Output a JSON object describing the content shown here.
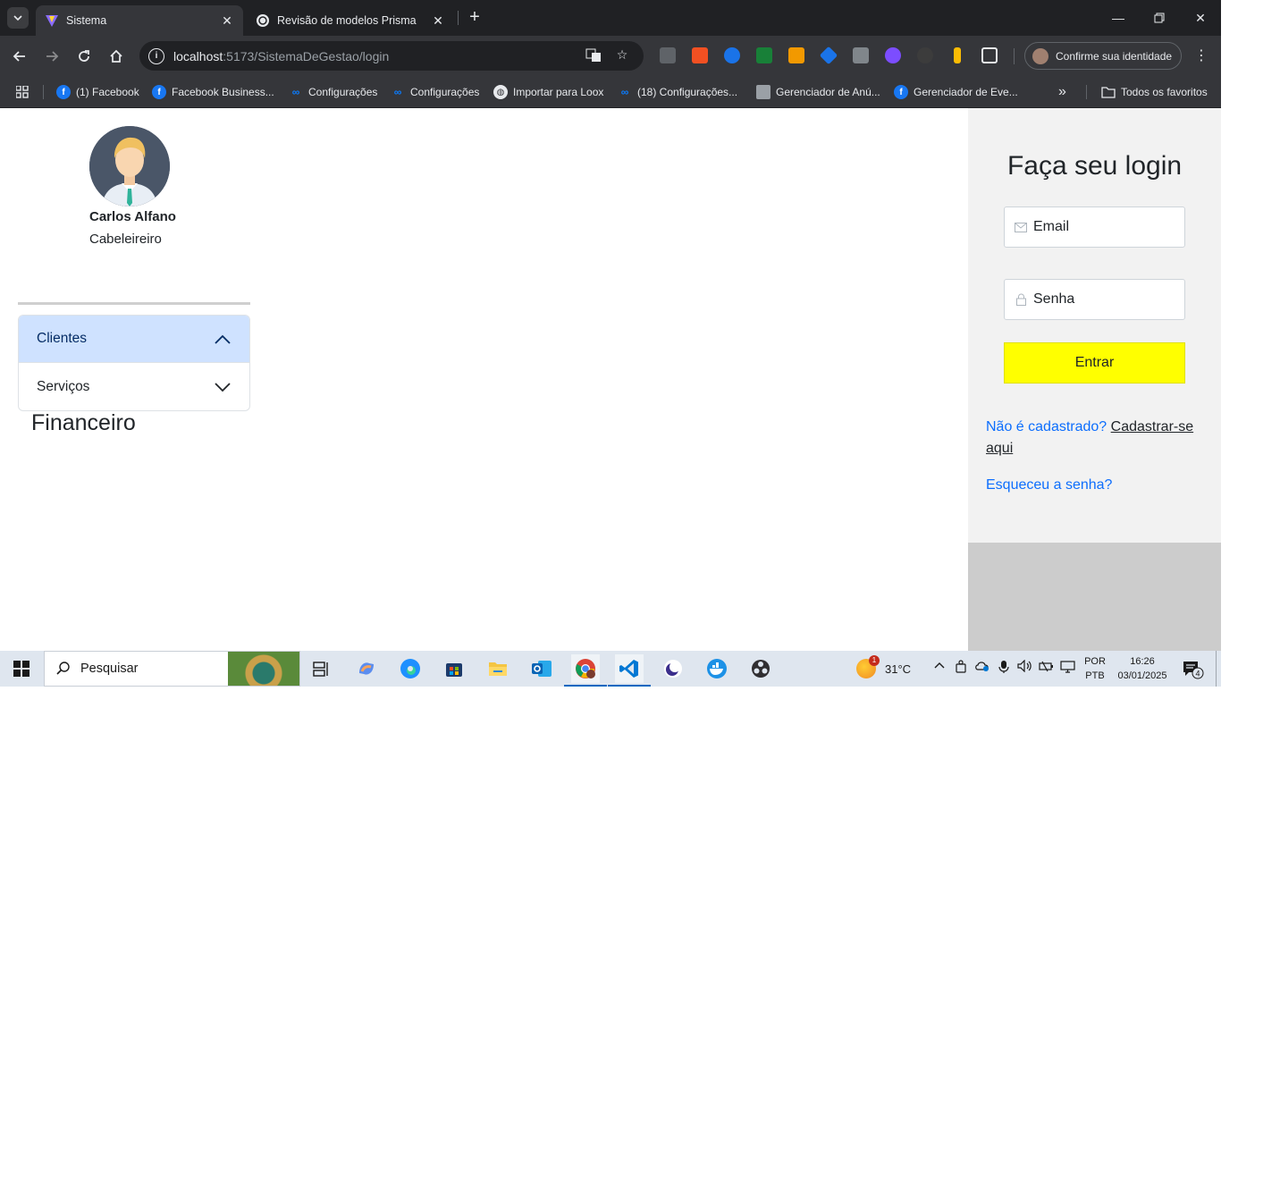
{
  "browser": {
    "tabs": [
      {
        "title": "Sistema",
        "active": true,
        "icon": "vite-logo-icon"
      },
      {
        "title": "Revisão de modelos Prisma",
        "active": false,
        "icon": "openai-icon"
      }
    ],
    "url": {
      "host": "localhost",
      "path": ":5173/SistemaDeGestao/login"
    },
    "profile_label": "Confirme sua identidade",
    "bookmarks": [
      {
        "label": "(1) Facebook",
        "icon": "facebook-icon"
      },
      {
        "label": "Facebook Business...",
        "icon": "facebook-icon"
      },
      {
        "label": "Configurações",
        "icon": "meta-icon"
      },
      {
        "label": "Configurações",
        "icon": "meta-icon"
      },
      {
        "label": "Importar para Loox",
        "icon": "globe-icon"
      },
      {
        "label": "(18) Configurações...",
        "icon": "meta-icon"
      },
      {
        "label": "Gerenciador de Anú...",
        "icon": "ads-icon"
      },
      {
        "label": "Gerenciador de Eve...",
        "icon": "facebook-icon"
      }
    ],
    "all_bookmarks_label": "Todos os favoritos"
  },
  "sidebar": {
    "profile_name": "Carlos Alfano",
    "profile_role": "Cabeleireiro",
    "accordion": [
      {
        "label": "Clientes",
        "open": true
      },
      {
        "label": "Serviços",
        "open": false
      }
    ],
    "financeiro_label": "Financeiro"
  },
  "login": {
    "title": "Faça seu login",
    "email_placeholder": "Email",
    "password_placeholder": "Senha",
    "submit_label": "Entrar",
    "signup_prompt": "Não é cadastrado?",
    "signup_link": "Cadastrar-se aqui",
    "forgot_link": "Esqueceu a senha?"
  },
  "taskbar": {
    "search_placeholder": "Pesquisar",
    "temperature": "31°C",
    "weather_badge": "1",
    "lang_line1": "POR",
    "lang_line2": "PTB",
    "time": "16:26",
    "date": "03/01/2025",
    "notifications": "4"
  },
  "colors": {
    "accent_button": "#ffff00",
    "accordion_open_bg": "#cfe2ff",
    "link_blue": "#0d6efd",
    "login_panel_bg": "#f2f2f2"
  }
}
